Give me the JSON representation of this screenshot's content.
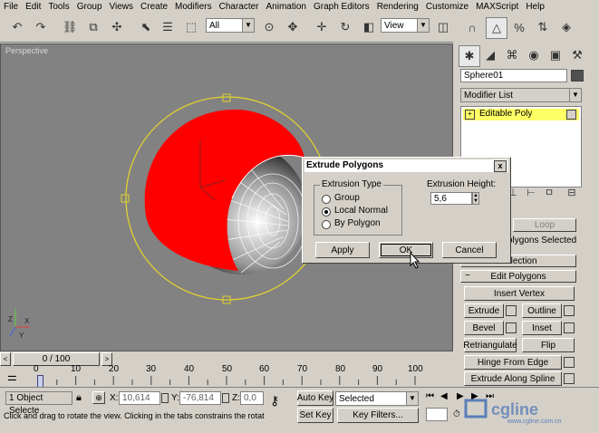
{
  "menu": [
    "File",
    "Edit",
    "Tools",
    "Group",
    "Views",
    "Create",
    "Modifiers",
    "Character",
    "Animation",
    "Graph Editors",
    "Rendering",
    "Customize",
    "MAXScript",
    "Help"
  ],
  "toolbar": {
    "selection_filter": "All",
    "ref_coord": "View"
  },
  "viewport": {
    "label": "Perspective"
  },
  "panel": {
    "object_name": "Sphere01",
    "modifier_list": "Modifier List",
    "stack_item": "Editable Poly",
    "loop_button": "Loop",
    "polygons_selected": "olygons Selected",
    "selection_button": "Selection",
    "edit_polygons_header": "Edit Polygons",
    "buttons": {
      "insert_vertex": "Insert Vertex",
      "extrude": "Extrude",
      "outline": "Outline",
      "bevel": "Bevel",
      "inset": "Inset",
      "retriangulate": "Retriangulate",
      "flip": "Flip",
      "hinge_from_edge": "Hinge From Edge",
      "extrude_along_spline": "Extrude Along Spline"
    }
  },
  "dialog": {
    "title": "Extrude Polygons",
    "group_title": "Extrusion Type",
    "options": [
      "Group",
      "Local Normal",
      "By Polygon"
    ],
    "selected_option": "Local Normal",
    "height_label": "Extrusion Height:",
    "height_value": "5,6",
    "apply": "Apply",
    "ok": "OK",
    "cancel": "Cancel",
    "close": "x"
  },
  "timeline": {
    "frame": "0 / 100",
    "ticks": [
      "0",
      "10",
      "20",
      "30",
      "40",
      "50",
      "60",
      "70",
      "80",
      "90",
      "100"
    ]
  },
  "status": {
    "selected": "1 Object Selecte",
    "x_label": "X:",
    "x_value": "10,614",
    "y_label": "Y:",
    "y_value": "-76,814",
    "z_label": "Z:",
    "z_value": "0,0",
    "auto_key": "Auto Key",
    "set_key": "Set Key",
    "key_mode": "Selected",
    "key_filters": "Key Filters...",
    "prompt": "Click and drag to rotate the view.  Clicking in the tabs constrains the rotat"
  },
  "watermark": "www.cgline.com.cn",
  "colors": {
    "ui_bg": "#d4d0c8",
    "viewport_bg": "#828282",
    "red_shell": "#ff0000",
    "selection_circle": "#e0d030",
    "stack_highlight": "#ffff66"
  }
}
